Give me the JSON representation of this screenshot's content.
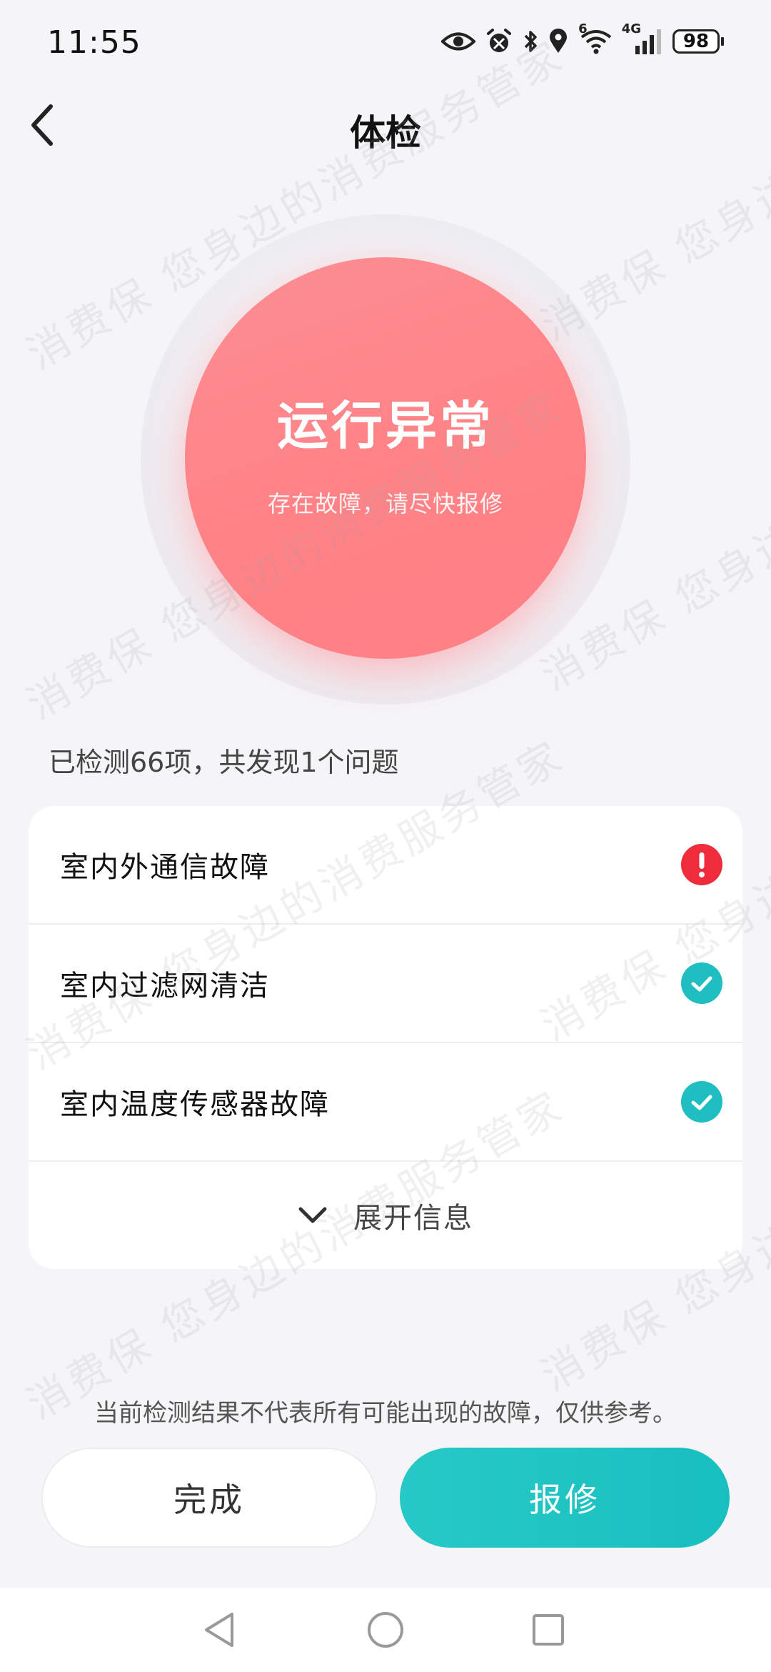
{
  "status_bar": {
    "time": "11:55",
    "network": "4G",
    "wifi_badge": "6",
    "battery": "98",
    "icons": [
      "eye-icon",
      "alarm-icon",
      "bluetooth-icon",
      "location-icon",
      "wifi-icon",
      "signal-icon",
      "battery-icon"
    ]
  },
  "header": {
    "title": "体检",
    "back_icon": "chevron-left-icon"
  },
  "status_circle": {
    "title": "运行异常",
    "subtitle": "存在故障，请尽快报修",
    "color": "#ff8286"
  },
  "summary": "已检测66项，共发现1个问题",
  "checks": [
    {
      "label": "室内外通信故障",
      "status": "error",
      "icon": "exclamation-icon"
    },
    {
      "label": "室内过滤网清洁",
      "status": "ok",
      "icon": "check-icon"
    },
    {
      "label": "室内温度传感器故障",
      "status": "ok",
      "icon": "check-icon"
    }
  ],
  "expand": {
    "label": "展开信息",
    "icon": "chevron-down-icon"
  },
  "disclaimer": "当前检测结果不代表所有可能出现的故障，仅供参考。",
  "buttons": {
    "done": "完成",
    "repair": "报修"
  },
  "colors": {
    "accent": "#1fbec0",
    "error": "#ee2c3c",
    "background": "#f5f5f8"
  },
  "nav": [
    "back-triangle-icon",
    "home-circle-icon",
    "recent-square-icon"
  ],
  "watermark": "消费保 您身边的消费服务管家"
}
